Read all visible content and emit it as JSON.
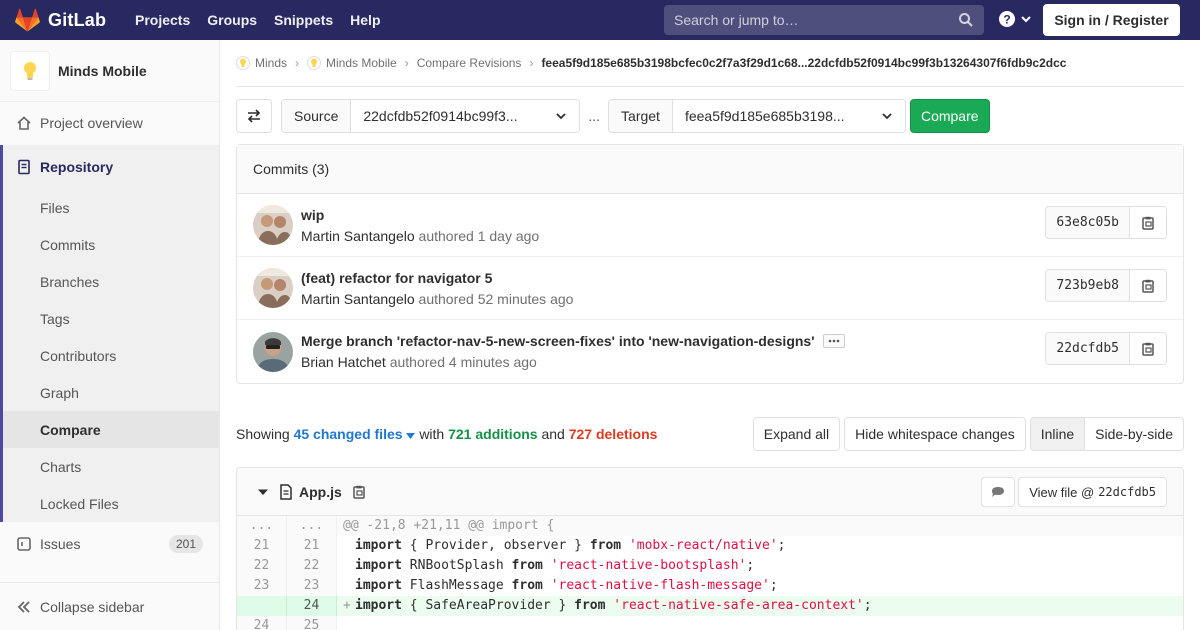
{
  "navbar": {
    "brand": "GitLab",
    "links": [
      "Projects",
      "Groups",
      "Snippets",
      "Help"
    ],
    "search_placeholder": "Search or jump to…",
    "signin_label": "Sign in / Register"
  },
  "sidebar": {
    "project_name": "Minds Mobile",
    "overview": "Project overview",
    "repository": "Repository",
    "repo_items": [
      "Files",
      "Commits",
      "Branches",
      "Tags",
      "Contributors",
      "Graph",
      "Compare",
      "Charts",
      "Locked Files"
    ],
    "active_item": "Compare",
    "issues": "Issues",
    "issues_count": "201",
    "collapse": "Collapse sidebar"
  },
  "breadcrumbs": [
    "Minds",
    "Minds Mobile",
    "Compare Revisions",
    "feea5f9d185e685b3198bcfec0c2f7a3f29d1c68...22dcfdb52f0914bc99f3b13264307f6fdb9c2dcc"
  ],
  "compare": {
    "source_label": "Source",
    "source_value": "22dcfdb52f0914bc99f3...",
    "dots": "...",
    "target_label": "Target",
    "target_value": "feea5f9d185e685b3198...",
    "compare_button": "Compare"
  },
  "commits": {
    "header": "Commits (3)",
    "items": [
      {
        "title": "wip",
        "author": "Martin Santangelo",
        "authored": "authored",
        "time": "1 day ago",
        "sha": "63e8c05b"
      },
      {
        "title": "(feat) refactor for navigator 5",
        "author": "Martin Santangelo",
        "authored": "authored",
        "time": "52 minutes ago",
        "sha": "723b9eb8"
      },
      {
        "title": "Merge branch 'refactor-nav-5-new-screen-fixes' into 'new-navigation-designs'",
        "author": "Brian Hatchet",
        "authored": "authored",
        "time": "4 minutes ago",
        "sha": "22dcfdb5"
      }
    ]
  },
  "summary": {
    "showing": "Showing",
    "changed_files": "45 changed files",
    "with": "with",
    "additions": "721 additions",
    "and": "and",
    "deletions": "727 deletions",
    "expand_all": "Expand all",
    "hide_whitespace": "Hide whitespace changes",
    "inline": "Inline",
    "side_by_side": "Side-by-side"
  },
  "file": {
    "name": "App.js",
    "view_file": "View file @",
    "view_sha": "22dcfdb5",
    "lines": [
      {
        "type": "match",
        "old": "...",
        "new": "...",
        "text": "@@ -21,8 +21,11 @@ import {"
      },
      {
        "type": "context",
        "old": "21",
        "new": "21",
        "kw1": "import",
        "mid": " { Provider, observer } ",
        "kw2": "from",
        "str": "'mobx-react/native'",
        "end": ";"
      },
      {
        "type": "context",
        "old": "22",
        "new": "22",
        "kw1": "import",
        "mid": " RNBootSplash ",
        "kw2": "from",
        "str": "'react-native-bootsplash'",
        "end": ";"
      },
      {
        "type": "context",
        "old": "23",
        "new": "23",
        "kw1": "import",
        "mid": " FlashMessage ",
        "kw2": "from",
        "str": "'react-native-flash-message'",
        "end": ";"
      },
      {
        "type": "add",
        "old": "",
        "new": "24",
        "marker": "+",
        "kw1": "import",
        "mid": " { SafeAreaProvider } ",
        "kw2": "from",
        "str": "'react-native-safe-area-context'",
        "end": ";"
      },
      {
        "type": "context",
        "old": "24",
        "new": "25",
        "kw1": "",
        "mid": "",
        "kw2": "",
        "str": "",
        "end": ""
      }
    ]
  },
  "colors": {
    "navbar": "#292961",
    "compare_button": "#1aaa55",
    "additions": "#168f48",
    "deletions": "#db3b21",
    "link": "#1f78d1"
  }
}
